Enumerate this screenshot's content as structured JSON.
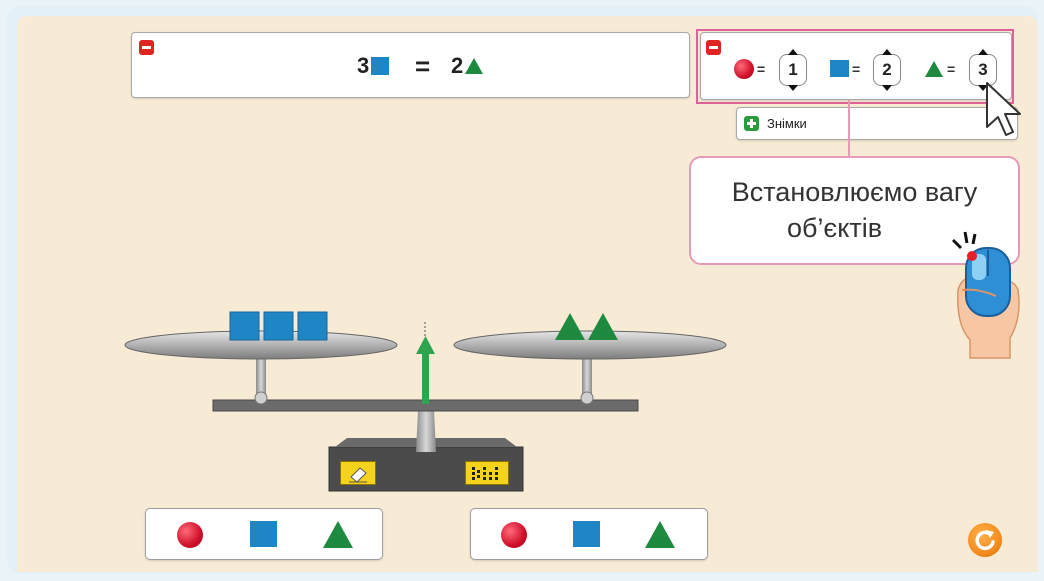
{
  "equation_panel": {
    "left_count": "3",
    "equals": "=",
    "right_count": "2"
  },
  "weights_panel": {
    "items": [
      {
        "shape": "circle",
        "eq": "=",
        "value": "1"
      },
      {
        "shape": "square",
        "eq": "=",
        "value": "2"
      },
      {
        "shape": "triangle",
        "eq": "=",
        "value": "3"
      }
    ]
  },
  "snapshots_button": {
    "label": "Знімки"
  },
  "callout": {
    "line1": "Встановлюємо вагу",
    "line2": "об’єктів"
  },
  "colors": {
    "background": "#f8ebd6",
    "square": "#1f86c6",
    "triangle": "#1e8a3f",
    "circle": "#d0102a",
    "highlight_border": "#e0609a",
    "arrow": "#2ea44f",
    "reset": "#f28a1c"
  },
  "icons": {
    "remove": "minus-icon",
    "add": "plus-icon",
    "eraser": "eraser-icon",
    "abacus": "abacus-icon",
    "reset": "refresh-icon",
    "cursor": "mouse-cursor-icon",
    "hand": "hand-mouse-icon"
  }
}
